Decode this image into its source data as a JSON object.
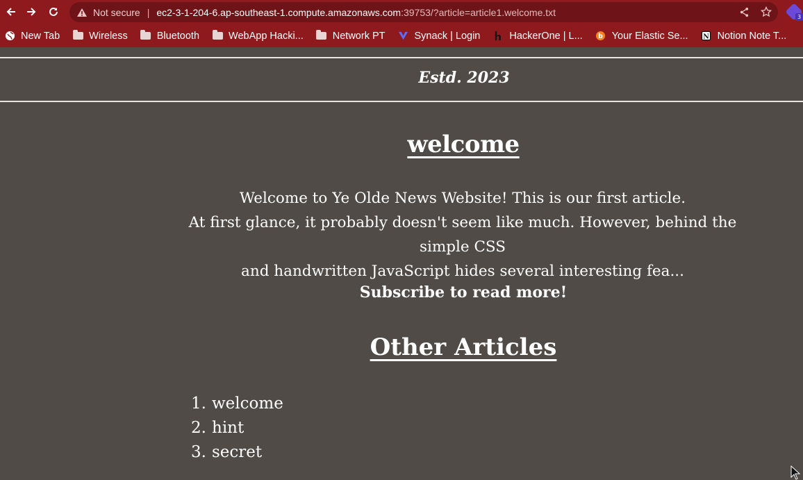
{
  "browser": {
    "url_warning": "Not secure",
    "url_host": "ec2-3-1-204-6.ap-southeast-1.compute.amazonaws.com",
    "url_rest": ":39753/?article=article1.welcome.txt",
    "extension_badge": "3",
    "accent_color": "#8e1a1e"
  },
  "bookmarks": [
    {
      "label": "New Tab",
      "icon": "globe-icon"
    },
    {
      "label": "Wireless",
      "icon": "folder-icon"
    },
    {
      "label": "Bluetooth",
      "icon": "folder-icon"
    },
    {
      "label": "WebApp Hacki...",
      "icon": "folder-icon"
    },
    {
      "label": "Network PT",
      "icon": "folder-icon"
    },
    {
      "label": "Synack | Login",
      "icon": "synack-icon"
    },
    {
      "label": "HackerOne | L...",
      "icon": "hackerone-icon"
    },
    {
      "label": "Your Elastic Se...",
      "icon": "elastic-icon"
    },
    {
      "label": "Notion Note T...",
      "icon": "notion-icon"
    }
  ],
  "page": {
    "established": "Estd. 2023",
    "article_title": "welcome",
    "body_lines": [
      "Welcome to Ye Olde News Website! This is our first article.",
      "At first glance, it probably doesn't seem like much. However, behind the simple CSS",
      "and handwritten JavaScript hides several interesting fea..."
    ],
    "subscribe": "Subscribe to read more!",
    "other_title": "Other Articles",
    "articles": [
      {
        "num": "1.",
        "label": "welcome"
      },
      {
        "num": "2.",
        "label": "hint"
      },
      {
        "num": "3.",
        "label": "secret"
      }
    ]
  }
}
